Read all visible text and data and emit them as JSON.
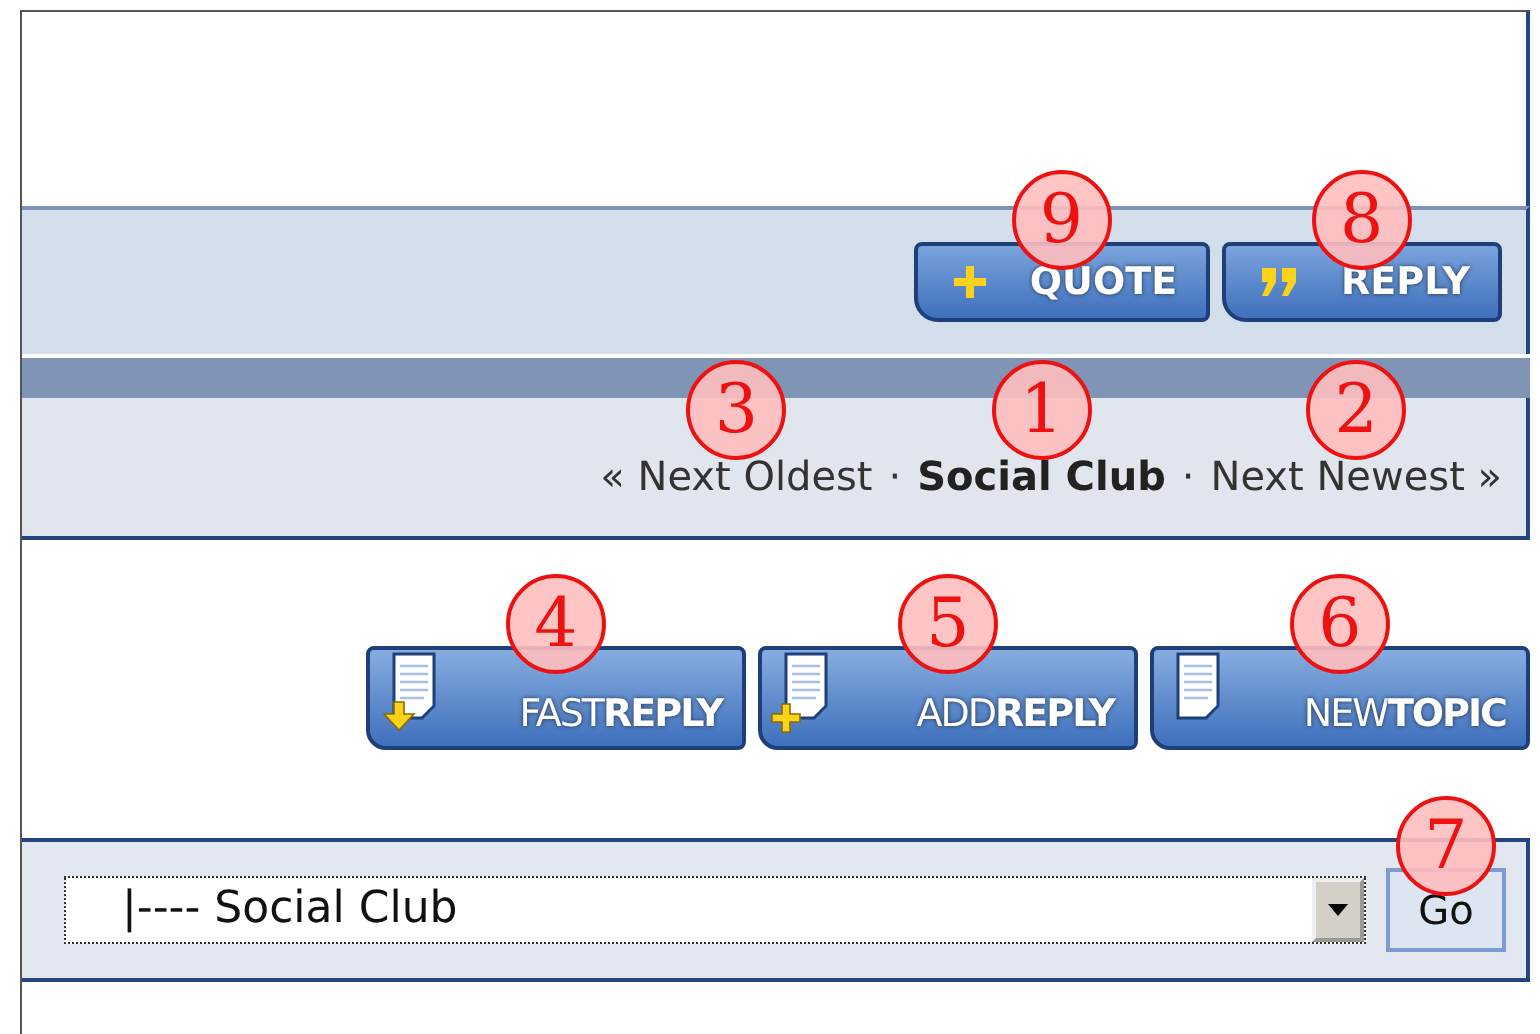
{
  "top_buttons": [
    {
      "kind": "quote",
      "label": "QUOTE",
      "callout": "9"
    },
    {
      "kind": "reply",
      "label": "REPLY",
      "callout": "8"
    }
  ],
  "nav": [
    {
      "kind": "link",
      "label": "« Next Oldest",
      "callout": "3"
    },
    {
      "kind": "separator",
      "label": "·"
    },
    {
      "kind": "current",
      "label": "Social Club",
      "callout": "1"
    },
    {
      "kind": "separator",
      "label": "·"
    },
    {
      "kind": "link",
      "label": "Next Newest »",
      "callout": "2"
    }
  ],
  "action_buttons": [
    {
      "kind": "fast",
      "label": "FAST**REPLY**",
      "callout": "4"
    },
    {
      "kind": "add",
      "label": "ADD**REPLY**",
      "callout": "5"
    },
    {
      "kind": "new",
      "label": "NEW**TOPIC**",
      "callout": "6"
    }
  ],
  "jump": {
    "value": "|---- Social Club",
    "button": "Go",
    "callout": "7"
  }
}
